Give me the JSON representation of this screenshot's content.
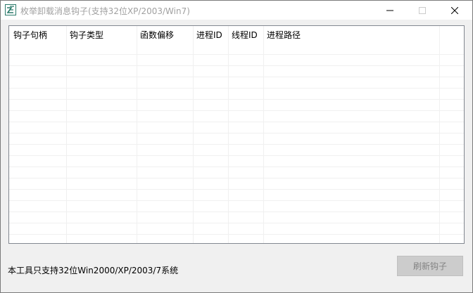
{
  "window": {
    "title": "枚举卸载消息钩子(支持32位XP/2003/Win7)",
    "controls": {
      "minimize_icon": "minimize-icon",
      "maximize_icon": "maximize-icon",
      "close_icon": "close-icon"
    },
    "title_color": "#a0a0a0"
  },
  "list": {
    "columns": [
      "钩子句柄",
      "钩子类型",
      "函数偏移",
      "进程ID",
      "线程ID",
      "进程路径"
    ],
    "rows": []
  },
  "status": {
    "text": "本工具只支持32位Win2000/XP/2003/7系统"
  },
  "buttons": {
    "refresh_label": "刷新钩子",
    "refresh_enabled": false
  }
}
